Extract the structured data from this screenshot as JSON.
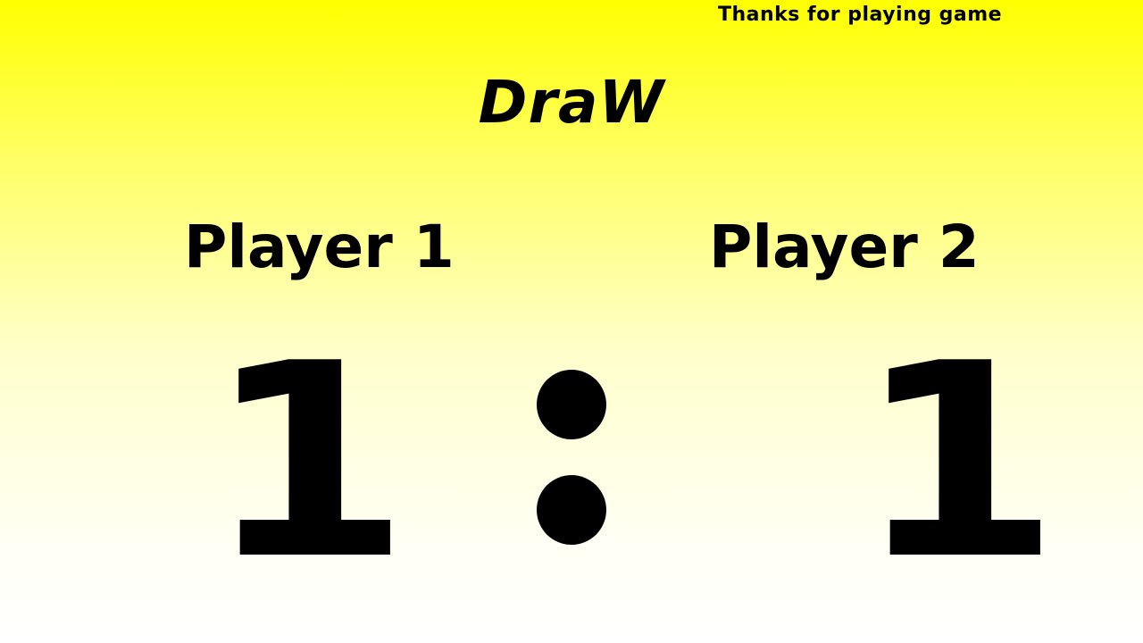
{
  "header": {
    "thanks_text": "Thanks for playing game"
  },
  "result": {
    "text": "DraW"
  },
  "players": [
    {
      "label": "Player 1",
      "score": "1"
    },
    {
      "label": "Player 2",
      "score": "1"
    }
  ],
  "score_separator": ":",
  "colors": {
    "background_top": "#ffff00",
    "background_bottom": "#ffffff",
    "text": "#000000"
  }
}
